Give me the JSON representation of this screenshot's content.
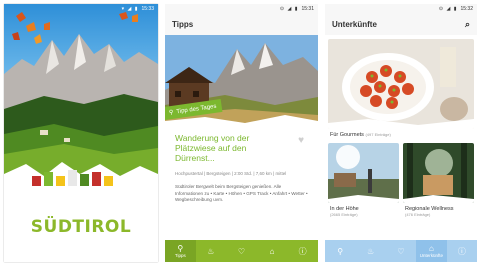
{
  "splash": {
    "time": "15:33",
    "logo_text": "SÜDTIROL"
  },
  "tips": {
    "time": "15:31",
    "title": "Tipps",
    "tag_label": "Tipp des Tages",
    "card_title": "Wanderung von der Plätzwiese auf den Dürrenst...",
    "meta": "Hochpustertal | Bergsteigen | 2:00 Std. | 7,60 km | mittel",
    "description": "Südtiroler Bergwelt beim Bergsteigen genießen. Alle Informationen zu • Karte • Höhen • GPS Track • Anfahrt • Wetter • Wegbeschreibung uvm.",
    "nav": [
      {
        "label": "Tipps",
        "icon": "pin-icon",
        "glyph": "⚲"
      },
      {
        "label": "",
        "icon": "activity-icon",
        "glyph": "♨"
      },
      {
        "label": "",
        "icon": "heart-icon",
        "glyph": "♡"
      },
      {
        "label": "",
        "icon": "home-icon",
        "glyph": "⌂"
      },
      {
        "label": "",
        "icon": "info-icon",
        "glyph": "ⓘ"
      }
    ]
  },
  "accommodations": {
    "time": "15:32",
    "title": "Unterkünfte",
    "featured": {
      "name": "Für Gourmets",
      "count": "(497 Einträge)"
    },
    "items": [
      {
        "name": "In der Höhe",
        "count": "(2665 Einträge)"
      },
      {
        "name": "Regionale Wellness",
        "count": "(476 Einträge)"
      }
    ],
    "nav": [
      {
        "label": "",
        "icon": "pin-icon",
        "glyph": "⚲"
      },
      {
        "label": "",
        "icon": "activity-icon",
        "glyph": "♨"
      },
      {
        "label": "",
        "icon": "heart-icon",
        "glyph": "♡"
      },
      {
        "label": "Unterkünfte",
        "icon": "home-icon",
        "glyph": "⌂"
      },
      {
        "label": "",
        "icon": "info-icon",
        "glyph": "ⓘ"
      }
    ]
  },
  "colors": {
    "brand_green": "#8cb82a",
    "nav_blue": "#a9d0ef"
  }
}
